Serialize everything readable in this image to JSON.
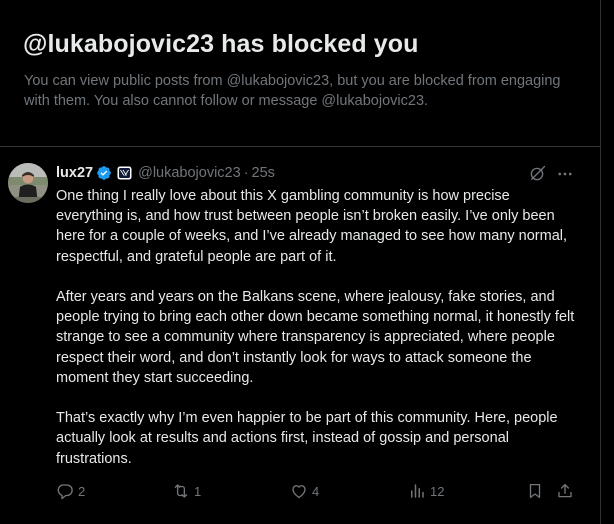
{
  "blocked": {
    "title": "@lukabojovic23 has blocked you",
    "description": "You can view public posts from @lukabojovic23, but you are blocked from engaging with them. You also cannot follow or message @lukabojovic23."
  },
  "post": {
    "display_name": "lux27",
    "handle": "@lukabojovic23",
    "separator": "·",
    "time": "25s",
    "paragraphs": [
      "One thing I really love about this X gambling community is how precise everything is, and how trust between people isn’t broken easily. I’ve only been here for a couple of weeks, and I’ve already managed to see how many normal, respectful, and grateful people are part of it.",
      "After years and years on the Balkans scene, where jealousy, fake stories, and people trying to bring each other down became something normal, it honestly felt strange to see a community where transparency is appreciated, where people respect their word, and don’t instantly look for ways to attack someone the moment they start succeeding.",
      "That’s exactly why I’m even happier to be part of this community. Here, people actually look at results and actions first, instead of gossip and personal frustrations."
    ],
    "actions": {
      "replies": "2",
      "reposts": "1",
      "likes": "4",
      "views": "12"
    }
  },
  "icons": {
    "verified": "verified-badge-icon",
    "affiliate": "affiliate-badge-icon",
    "grok": "grok-icon",
    "more": "more-icon",
    "reply": "reply-icon",
    "repost": "repost-icon",
    "like": "heart-icon",
    "views": "views-icon",
    "bookmark": "bookmark-icon",
    "share": "share-icon"
  },
  "colors": {
    "background": "#000000",
    "text_primary": "#e7e9ea",
    "text_secondary": "#71767b",
    "border": "#2f3336",
    "verified_blue": "#1d9bf0"
  }
}
